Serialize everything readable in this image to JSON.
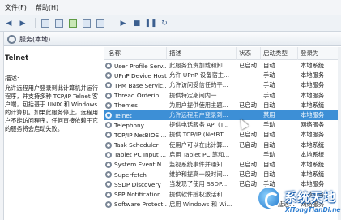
{
  "menubar": {
    "items": [
      "文件(F)",
      "帮助(H)"
    ]
  },
  "header": {
    "title": "服务(本地)"
  },
  "description": {
    "service_name": "Telnet",
    "label": "描述:",
    "text": "允许远程用户登录到此计算机并运行程序，并支持多种 TCP/IP Telnet 客户端，包括基于 UNIX 和 Windows 的计算机。如果此服务停止，远程用户不能访问程序，任何直接依赖于它的服务将会启动失败。"
  },
  "columns": [
    "名称",
    "描述",
    "状态",
    "启动类型",
    "登录为"
  ],
  "services": [
    {
      "name": "User Profile Serv...",
      "desc": "此服务负责加载和卸...",
      "status": "已启动",
      "startup": "自动",
      "logon": "本地系统",
      "icon": "gear-icon"
    },
    {
      "name": "UPnP Device Host",
      "desc": "允许 UPnP 设备宿主...",
      "status": "",
      "startup": "手动",
      "logon": "本地服务",
      "icon": "gear-icon"
    },
    {
      "name": "TPM Base Servic...",
      "desc": "允许访问受信任的平...",
      "status": "",
      "startup": "手动",
      "logon": "本地服务",
      "icon": "gear-icon"
    },
    {
      "name": "Thread Orderin...",
      "desc": "提供特定期间内一...",
      "status": "",
      "startup": "手动",
      "logon": "本地服务",
      "icon": "gear-icon"
    },
    {
      "name": "Themes",
      "desc": "为用户提供使用主题...",
      "status": "已启动",
      "startup": "自动",
      "logon": "本地系统",
      "icon": "gear-icon"
    },
    {
      "name": "Telnet",
      "desc": "允许远程用户登录到...",
      "status": "",
      "startup": "禁用",
      "logon": "本地服务",
      "icon": "gear-icon",
      "selected": true
    },
    {
      "name": "Telephony",
      "desc": "提供电话服务 API (T...",
      "status": "",
      "startup": "手动",
      "logon": "网络服务",
      "icon": "gear-icon"
    },
    {
      "name": "TCP/IP NetBIOS ...",
      "desc": "提供 TCP/IP (NetBT...",
      "status": "已启动",
      "startup": "自动",
      "logon": "本地服务",
      "icon": "gear-icon"
    },
    {
      "name": "Task Scheduler",
      "desc": "使用户可以在此计算...",
      "status": "已启动",
      "startup": "自动",
      "logon": "本地系统",
      "icon": "gear-icon"
    },
    {
      "name": "Tablet PC Input ...",
      "desc": "启用 Tablet PC 笔和...",
      "status": "",
      "startup": "手动",
      "logon": "本地系统",
      "icon": "gear-icon"
    },
    {
      "name": "System Event N...",
      "desc": "监视系统事件并通知...",
      "status": "已启动",
      "startup": "自动",
      "logon": "本地系统",
      "icon": "gear-icon"
    },
    {
      "name": "Superfetch",
      "desc": "维护和提高一段时间...",
      "status": "已启动",
      "startup": "自动",
      "logon": "本地系统",
      "icon": "gear-icon"
    },
    {
      "name": "SSDP Discovery",
      "desc": "当发现了使用 SSDP...",
      "status": "已启动",
      "startup": "手动",
      "logon": "本地服务",
      "icon": "gear-icon"
    },
    {
      "name": "SPP Notification ...",
      "desc": "提供软件授权激活和...",
      "status": "",
      "startup": "手动",
      "logon": "本地服务",
      "icon": "gear-icon"
    },
    {
      "name": "Software Protect...",
      "desc": "启用 Windows 和 Wi...",
      "status": "",
      "startup": "自动(延迟...",
      "logon": "网络服务",
      "icon": "gear-icon"
    }
  ],
  "watermark": {
    "title": "系统天地",
    "url": "XiTongTianDi.net"
  },
  "colors": {
    "selection": "#3d8fd6",
    "watermark": "#1d74c9"
  }
}
